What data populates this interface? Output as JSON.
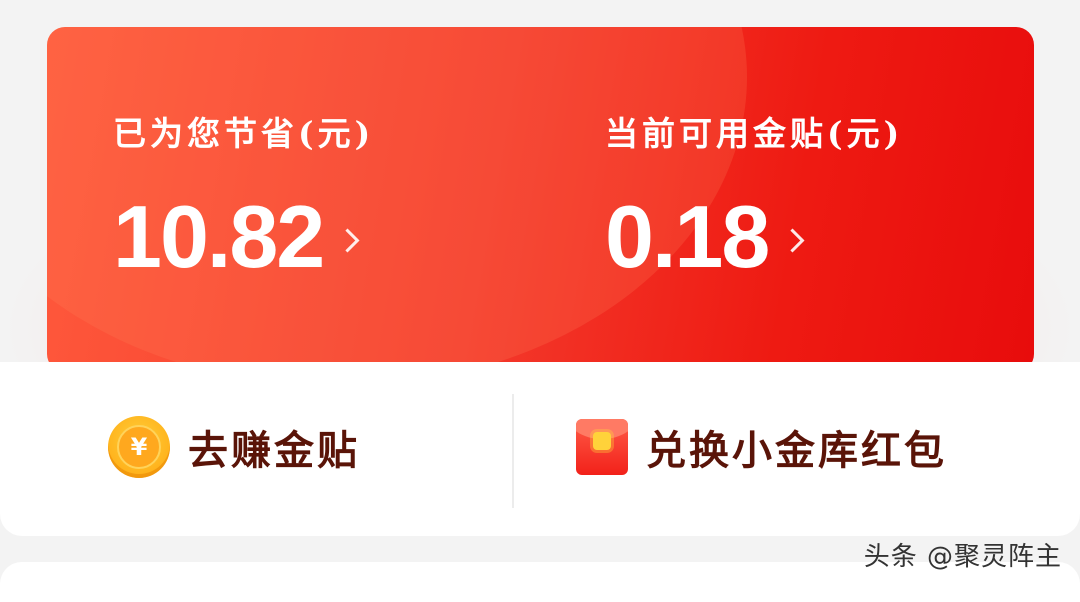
{
  "banner": {
    "saved_label": "已为您节省(元)",
    "saved_value": "10.82",
    "balance_label": "当前可用金贴(元)",
    "balance_value": "0.18"
  },
  "actions": {
    "earn_label": "去赚金贴",
    "earn_icon": "coin-icon",
    "coin_symbol": "¥",
    "redeem_label": "兑换小金库红包",
    "redeem_icon": "red-packet-icon"
  },
  "watermark": "头条 @聚灵阵主",
  "colors": {
    "banner_start": "#ff5a3c",
    "banner_end": "#e80c0c",
    "action_text": "#5a1408",
    "coin": "#ffb21c"
  }
}
